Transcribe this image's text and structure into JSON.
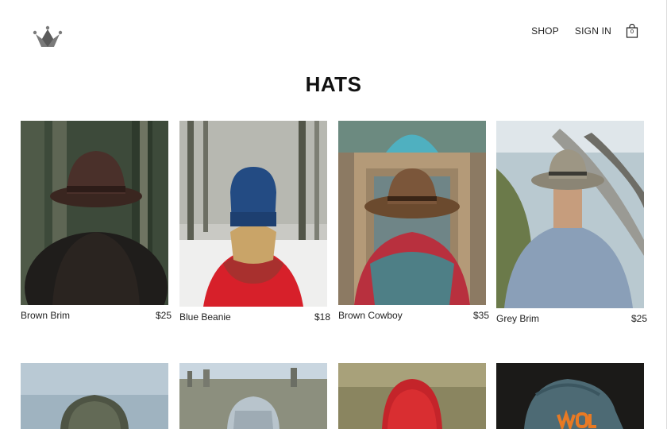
{
  "header": {
    "logo_icon": "crown-icon",
    "nav": {
      "shop": "SHOP",
      "sign_in": "SIGN IN"
    },
    "cart": {
      "icon": "shopping-bag-icon",
      "count": "0"
    }
  },
  "page": {
    "title": "HATS"
  },
  "products": [
    {
      "name": "Brown Brim",
      "price": "$25"
    },
    {
      "name": "Blue Beanie",
      "price": "$18"
    },
    {
      "name": "Brown Cowboy",
      "price": "$35"
    },
    {
      "name": "Grey Brim",
      "price": "$25"
    }
  ]
}
